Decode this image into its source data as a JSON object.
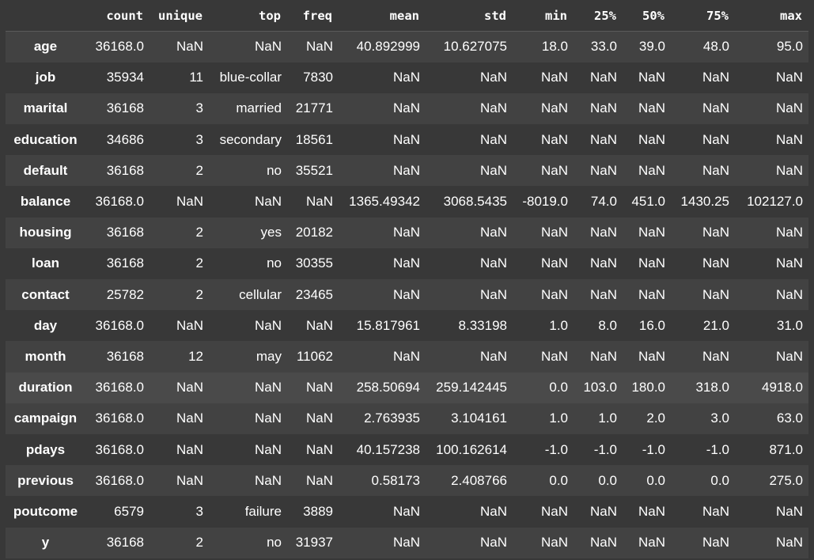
{
  "columns": [
    "",
    "count",
    "unique",
    "top",
    "freq",
    "mean",
    "std",
    "min",
    "25%",
    "50%",
    "75%",
    "max"
  ],
  "rows": [
    {
      "index": "age",
      "cells": [
        "36168.0",
        "NaN",
        "NaN",
        "NaN",
        "40.892999",
        "10.627075",
        "18.0",
        "33.0",
        "39.0",
        "48.0",
        "95.0"
      ]
    },
    {
      "index": "job",
      "cells": [
        "35934",
        "11",
        "blue-collar",
        "7830",
        "NaN",
        "NaN",
        "NaN",
        "NaN",
        "NaN",
        "NaN",
        "NaN"
      ]
    },
    {
      "index": "marital",
      "cells": [
        "36168",
        "3",
        "married",
        "21771",
        "NaN",
        "NaN",
        "NaN",
        "NaN",
        "NaN",
        "NaN",
        "NaN"
      ]
    },
    {
      "index": "education",
      "cells": [
        "34686",
        "3",
        "secondary",
        "18561",
        "NaN",
        "NaN",
        "NaN",
        "NaN",
        "NaN",
        "NaN",
        "NaN"
      ]
    },
    {
      "index": "default",
      "cells": [
        "36168",
        "2",
        "no",
        "35521",
        "NaN",
        "NaN",
        "NaN",
        "NaN",
        "NaN",
        "NaN",
        "NaN"
      ]
    },
    {
      "index": "balance",
      "cells": [
        "36168.0",
        "NaN",
        "NaN",
        "NaN",
        "1365.49342",
        "3068.5435",
        "-8019.0",
        "74.0",
        "451.0",
        "1430.25",
        "102127.0"
      ]
    },
    {
      "index": "housing",
      "cells": [
        "36168",
        "2",
        "yes",
        "20182",
        "NaN",
        "NaN",
        "NaN",
        "NaN",
        "NaN",
        "NaN",
        "NaN"
      ]
    },
    {
      "index": "loan",
      "cells": [
        "36168",
        "2",
        "no",
        "30355",
        "NaN",
        "NaN",
        "NaN",
        "NaN",
        "NaN",
        "NaN",
        "NaN"
      ]
    },
    {
      "index": "contact",
      "cells": [
        "25782",
        "2",
        "cellular",
        "23465",
        "NaN",
        "NaN",
        "NaN",
        "NaN",
        "NaN",
        "NaN",
        "NaN"
      ]
    },
    {
      "index": "day",
      "cells": [
        "36168.0",
        "NaN",
        "NaN",
        "NaN",
        "15.817961",
        "8.33198",
        "1.0",
        "8.0",
        "16.0",
        "21.0",
        "31.0"
      ]
    },
    {
      "index": "month",
      "cells": [
        "36168",
        "12",
        "may",
        "11062",
        "NaN",
        "NaN",
        "NaN",
        "NaN",
        "NaN",
        "NaN",
        "NaN"
      ]
    },
    {
      "index": "duration",
      "cells": [
        "36168.0",
        "NaN",
        "NaN",
        "NaN",
        "258.50694",
        "259.142445",
        "0.0",
        "103.0",
        "180.0",
        "318.0",
        "4918.0"
      ]
    },
    {
      "index": "campaign",
      "cells": [
        "36168.0",
        "NaN",
        "NaN",
        "NaN",
        "2.763935",
        "3.104161",
        "1.0",
        "1.0",
        "2.0",
        "3.0",
        "63.0"
      ]
    },
    {
      "index": "pdays",
      "cells": [
        "36168.0",
        "NaN",
        "NaN",
        "NaN",
        "40.157238",
        "100.162614",
        "-1.0",
        "-1.0",
        "-1.0",
        "-1.0",
        "871.0"
      ]
    },
    {
      "index": "previous",
      "cells": [
        "36168.0",
        "NaN",
        "NaN",
        "NaN",
        "0.58173",
        "2.408766",
        "0.0",
        "0.0",
        "0.0",
        "0.0",
        "275.0"
      ]
    },
    {
      "index": "poutcome",
      "cells": [
        "6579",
        "3",
        "failure",
        "3889",
        "NaN",
        "NaN",
        "NaN",
        "NaN",
        "NaN",
        "NaN",
        "NaN"
      ]
    },
    {
      "index": "y",
      "cells": [
        "36168",
        "2",
        "no",
        "31937",
        "NaN",
        "NaN",
        "NaN",
        "NaN",
        "NaN",
        "NaN",
        "NaN"
      ]
    }
  ],
  "highlighted_row": "duration"
}
